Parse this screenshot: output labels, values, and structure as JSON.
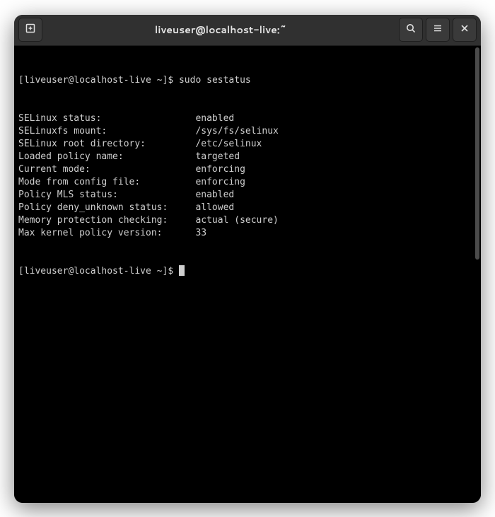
{
  "window": {
    "title": "liveuser@localhost-live:~"
  },
  "prompt": {
    "user_host": "[liveuser@localhost-live ~]$ ",
    "command": "sudo sestatus"
  },
  "output": {
    "rows": [
      {
        "label": "SELinux status:",
        "value": "enabled"
      },
      {
        "label": "SELinuxfs mount:",
        "value": "/sys/fs/selinux"
      },
      {
        "label": "SELinux root directory:",
        "value": "/etc/selinux"
      },
      {
        "label": "Loaded policy name:",
        "value": "targeted"
      },
      {
        "label": "Current mode:",
        "value": "enforcing"
      },
      {
        "label": "Mode from config file:",
        "value": "enforcing"
      },
      {
        "label": "Policy MLS status:",
        "value": "enabled"
      },
      {
        "label": "Policy deny_unknown status:",
        "value": "allowed"
      },
      {
        "label": "Memory protection checking:",
        "value": "actual (secure)"
      },
      {
        "label": "Max kernel policy version:",
        "value": "33"
      }
    ],
    "label_width": 32
  },
  "prompt2": {
    "text": "[liveuser@localhost-live ~]$ "
  }
}
